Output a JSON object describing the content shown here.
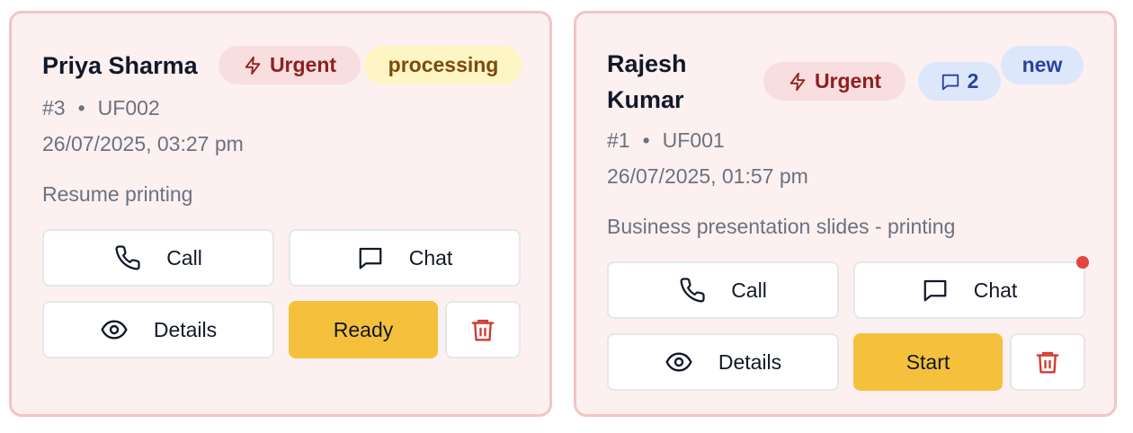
{
  "orders": [
    {
      "customer_name": "Priya Sharma",
      "priority_label": "Urgent",
      "status": "processing",
      "number": "#3",
      "customer_id": "UF002",
      "datetime": "26/07/2025, 03:27 pm",
      "description": "Resume printing",
      "call_label": "Call",
      "chat_label": "Chat",
      "details_label": "Details",
      "action_label": "Ready"
    },
    {
      "customer_name_line1": "Rajesh",
      "customer_name_line2": "Kumar",
      "priority_label": "Urgent",
      "message_count": "2",
      "status": "new",
      "number": "#1",
      "customer_id": "UF001",
      "datetime": "26/07/2025, 01:57 pm",
      "description": "Business presentation slides - printing",
      "call_label": "Call",
      "chat_label": "Chat",
      "details_label": "Details",
      "action_label": "Start",
      "has_unread_chat": true
    }
  ],
  "separator": "•",
  "colors": {
    "card_bg": "#fdf0f0",
    "card_border": "#f3c4c4",
    "urgent": "#8f2020",
    "processing": "#7d4a0f",
    "new": "#2b40a0",
    "primary_button": "#f5c13d",
    "delete": "#d13b33"
  }
}
